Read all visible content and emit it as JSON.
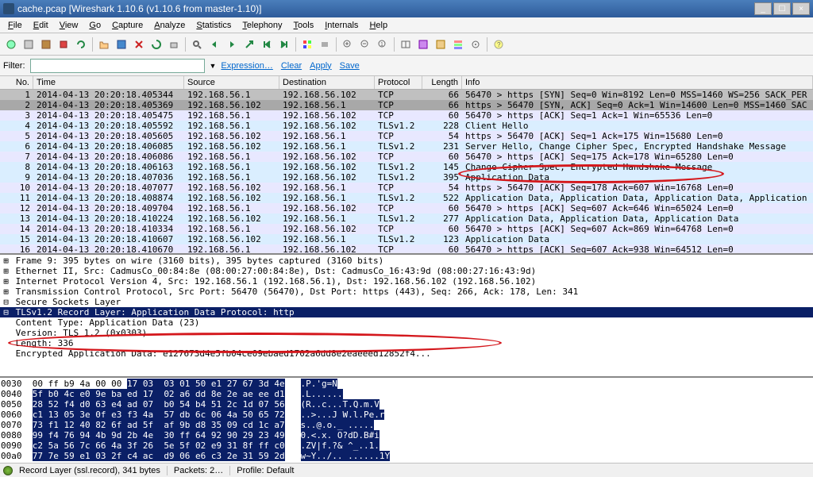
{
  "window_title": "cache.pcap   [Wireshark 1.10.6  (v1.10.6 from master-1.10)]",
  "menu": [
    "File",
    "Edit",
    "View",
    "Go",
    "Capture",
    "Analyze",
    "Statistics",
    "Telephony",
    "Tools",
    "Internals",
    "Help"
  ],
  "filter": {
    "label": "Filter:",
    "value": "",
    "expression": "Expression…",
    "clear": "Clear",
    "apply": "Apply",
    "save": "Save"
  },
  "columns": {
    "no": "No.",
    "time": "Time",
    "src": "Source",
    "dst": "Destination",
    "proto": "Protocol",
    "len": "Length",
    "info": "Info"
  },
  "packets": [
    {
      "no": 1,
      "time": "2014-04-13 20:20:18.405344",
      "src": "192.168.56.1",
      "dst": "192.168.56.102",
      "proto": "TCP",
      "len": 66,
      "info": "56470 > https [SYN] Seq=0 Win=8192 Len=0 MSS=1460 WS=256 SACK_PER",
      "cls": "selected"
    },
    {
      "no": 2,
      "time": "2014-04-13 20:20:18.405369",
      "src": "192.168.56.102",
      "dst": "192.168.56.1",
      "proto": "TCP",
      "len": 66,
      "info": "https > 56470 [SYN, ACK] Seq=0 Ack=1 Win=14600 Len=0 MSS=1460 SAC",
      "cls": "selected2"
    },
    {
      "no": 3,
      "time": "2014-04-13 20:20:18.405475",
      "src": "192.168.56.1",
      "dst": "192.168.56.102",
      "proto": "TCP",
      "len": 60,
      "info": "56470 > https [ACK] Seq=1 Ack=1 Win=65536 Len=0",
      "cls": "tcp"
    },
    {
      "no": 4,
      "time": "2014-04-13 20:20:18.405592",
      "src": "192.168.56.1",
      "dst": "192.168.56.102",
      "proto": "TLSv1.2",
      "len": 228,
      "info": "Client Hello",
      "cls": "tls"
    },
    {
      "no": 5,
      "time": "2014-04-13 20:20:18.405605",
      "src": "192.168.56.102",
      "dst": "192.168.56.1",
      "proto": "TCP",
      "len": 54,
      "info": "https > 56470 [ACK] Seq=1 Ack=175 Win=15680 Len=0",
      "cls": "tcp"
    },
    {
      "no": 6,
      "time": "2014-04-13 20:20:18.406085",
      "src": "192.168.56.102",
      "dst": "192.168.56.1",
      "proto": "TLSv1.2",
      "len": 231,
      "info": "Server Hello, Change Cipher Spec, Encrypted Handshake Message",
      "cls": "tls"
    },
    {
      "no": 7,
      "time": "2014-04-13 20:20:18.406086",
      "src": "192.168.56.1",
      "dst": "192.168.56.102",
      "proto": "TCP",
      "len": 60,
      "info": "56470 > https [ACK] Seq=175 Ack=178 Win=65280 Len=0",
      "cls": "tcp"
    },
    {
      "no": 8,
      "time": "2014-04-13 20:20:18.406163",
      "src": "192.168.56.1",
      "dst": "192.168.56.102",
      "proto": "TLSv1.2",
      "len": 145,
      "info": "Change Cipher Spec, Encrypted Handshake Message",
      "cls": "tls"
    },
    {
      "no": 9,
      "time": "2014-04-13 20:20:18.407036",
      "src": "192.168.56.1",
      "dst": "192.168.56.102",
      "proto": "TLSv1.2",
      "len": 395,
      "info": "Application Data",
      "cls": "tls"
    },
    {
      "no": 10,
      "time": "2014-04-13 20:20:18.407077",
      "src": "192.168.56.102",
      "dst": "192.168.56.1",
      "proto": "TCP",
      "len": 54,
      "info": "https > 56470 [ACK] Seq=178 Ack=607 Win=16768 Len=0",
      "cls": "tcp"
    },
    {
      "no": 11,
      "time": "2014-04-13 20:20:18.408874",
      "src": "192.168.56.102",
      "dst": "192.168.56.1",
      "proto": "TLSv1.2",
      "len": 522,
      "info": "Application Data, Application Data, Application Data, Application",
      "cls": "tls"
    },
    {
      "no": 12,
      "time": "2014-04-13 20:20:18.409704",
      "src": "192.168.56.1",
      "dst": "192.168.56.102",
      "proto": "TCP",
      "len": 60,
      "info": "56470 > https [ACK] Seq=607 Ack=646 Win=65024 Len=0",
      "cls": "tcp"
    },
    {
      "no": 13,
      "time": "2014-04-13 20:20:18.410224",
      "src": "192.168.56.102",
      "dst": "192.168.56.1",
      "proto": "TLSv1.2",
      "len": 277,
      "info": "Application Data, Application Data, Application Data",
      "cls": "tls"
    },
    {
      "no": 14,
      "time": "2014-04-13 20:20:18.410334",
      "src": "192.168.56.1",
      "dst": "192.168.56.102",
      "proto": "TCP",
      "len": 60,
      "info": "56470 > https [ACK] Seq=607 Ack=869 Win=64768 Len=0",
      "cls": "tcp"
    },
    {
      "no": 15,
      "time": "2014-04-13 20:20:18.410607",
      "src": "192.168.56.102",
      "dst": "192.168.56.1",
      "proto": "TLSv1.2",
      "len": 123,
      "info": "Application Data",
      "cls": "tls"
    },
    {
      "no": 16,
      "time": "2014-04-13 20:20:18.410670",
      "src": "192.168.56.1",
      "dst": "192.168.56.102",
      "proto": "TCP",
      "len": 60,
      "info": "56470 > https [ACK] Seq=607 Ack=938 Win=64512 Len=0",
      "cls": "tcp"
    },
    {
      "no": 17,
      "time": "2014-04-13 20:20:18.410771",
      "src": "192.168.56.102",
      "dst": "192.168.56.1",
      "proto": "TLSv1.2",
      "len": 123,
      "info": "Encrypted Alert",
      "cls": "tls"
    }
  ],
  "details": [
    {
      "pfx": "⊞",
      "text": "Frame 9: 395 bytes on wire (3160 bits), 395 bytes captured (3160 bits)",
      "cls": ""
    },
    {
      "pfx": "⊞",
      "text": "Ethernet II, Src: CadmusCo_00:84:8e (08:00:27:00:84:8e), Dst: CadmusCo_16:43:9d (08:00:27:16:43:9d)",
      "cls": ""
    },
    {
      "pfx": "⊞",
      "text": "Internet Protocol Version 4, Src: 192.168.56.1 (192.168.56.1), Dst: 192.168.56.102 (192.168.56.102)",
      "cls": ""
    },
    {
      "pfx": "⊞",
      "text": "Transmission Control Protocol, Src Port: 56470 (56470), Dst Port: https (443), Seq: 266, Ack: 178, Len: 341",
      "cls": ""
    },
    {
      "pfx": "⊟",
      "text": "Secure Sockets Layer",
      "cls": ""
    },
    {
      "pfx": "  ⊟",
      "text": "TLSv1.2 Record Layer: Application Data Protocol: http",
      "cls": "details-highlight"
    },
    {
      "pfx": "    ",
      "text": "Content Type: Application Data (23)",
      "cls": ""
    },
    {
      "pfx": "    ",
      "text": "Version: TLS 1.2 (0x0303)",
      "cls": ""
    },
    {
      "pfx": "    ",
      "text": "Length: 336",
      "cls": ""
    },
    {
      "pfx": "    ",
      "text": "Encrypted Application Data: e127673d4e5fb04ce09ebaed1702a6dd8e2eaeeed12852f4...",
      "cls": ""
    }
  ],
  "hex": [
    {
      "off": "0030",
      "b1": "00 ff b9 4a 00 00",
      "b2": "17 03  03 01 50 e1 27 67 3d 4e",
      "a": ".P.'g=N"
    },
    {
      "off": "0040",
      "b1": "5f b0 4c e0 9e ba ed 17",
      "b2": "02 a6 dd 8e 2e ae ee d1",
      "a": ".L......"
    },
    {
      "off": "0050",
      "b1": "28 52 f4 d0 63 e4 ad 07",
      "b2": "b0 54 b4 51 2c 1d 07 56",
      "a": "(R..c...T.Q.m.V"
    },
    {
      "off": "0060",
      "b1": "c1 13 05 3e 0f e3 f3 4a",
      "b2": "57 db 6c 06 4a 50 65 72",
      "a": "..>...J W.l.Pe.r"
    },
    {
      "off": "0070",
      "b1": "73 f1 12 40 82 6f ad 5f",
      "b2": "af 9b d8 35 09 cd 1c a7",
      "a": "s..@.o._ ....."
    },
    {
      "off": "0080",
      "b1": "99 f4 76 94 4b 9d 2b 4e",
      "b2": "30 ff 64 92 90 29 23 49",
      "a": "0.<.x. O?dD.B#i"
    },
    {
      "off": "0090",
      "b1": "c2 5a 56 7c 66 4a 3f 26",
      "b2": "5e 5f 02 e9 31 8f ff c0",
      "a": ".ZV|f.?& ^_..1."
    },
    {
      "off": "00a0",
      "b1": "77 7e 59 e1 03 2f c4 ac",
      "b2": "d9 06 e6 c3 2e 31 59 2d",
      "a": "w~Y../.. ......1Y"
    }
  ],
  "status": {
    "layer": "Record Layer (ssl.record), 341 bytes",
    "packets": "Packets: 2…",
    "profile": "Profile: Default"
  }
}
